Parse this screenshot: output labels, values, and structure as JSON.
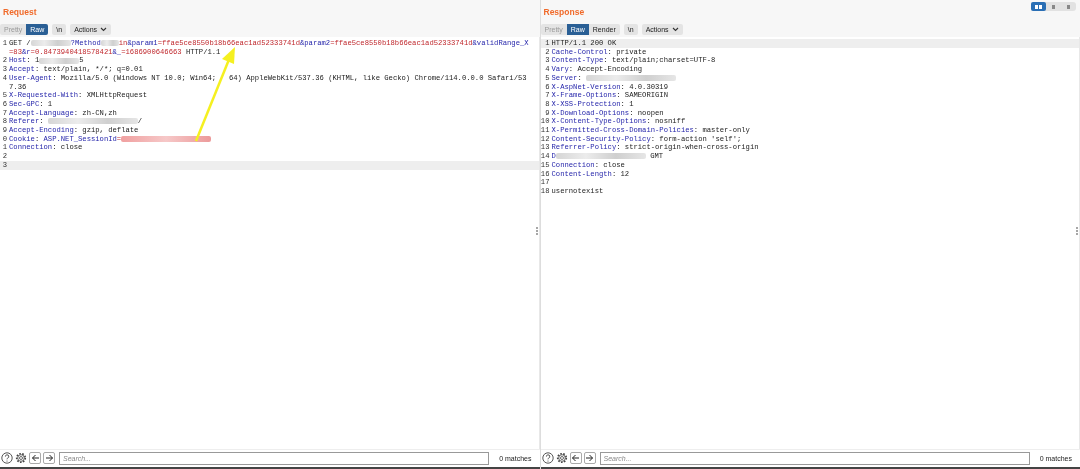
{
  "layout_buttons": [
    {
      "selected": true
    },
    {
      "selected": false
    },
    {
      "selected": false
    }
  ],
  "panes": [
    {
      "title": "Request",
      "tabs": [
        {
          "label": "Pretty",
          "selected": false,
          "disabled": true
        },
        {
          "label": "Raw",
          "selected": true,
          "disabled": false
        }
      ],
      "newline_button": "\\n",
      "actions_button": "Actions",
      "arrow_annotation": true,
      "lines": [
        {
          "number": "1",
          "active": false,
          "segments": [
            {
              "kind": "plain",
              "text": "GET /"
            },
            {
              "kind": "blur_medium"
            },
            {
              "kind": "param",
              "text": "?Method"
            },
            {
              "kind": "blur_short"
            },
            {
              "kind": "value",
              "text": "in"
            },
            {
              "kind": "param",
              "text": "&param1"
            },
            {
              "kind": "value",
              "text": "=ffae5ce8550b18b66eac1ad52333741d"
            },
            {
              "kind": "param",
              "text": "&param2"
            },
            {
              "kind": "value",
              "text": "=ffae5ce8550b18b66eac1ad52333741d"
            },
            {
              "kind": "param",
              "text": "&validRange_X"
            },
            {
              "kind": "value",
              "text": "=83"
            },
            {
              "kind": "param",
              "text": "&r"
            },
            {
              "kind": "value",
              "text": "=0.8473940418578421"
            },
            {
              "kind": "param",
              "text": "&_"
            },
            {
              "kind": "value",
              "text": "=1686900646663"
            },
            {
              "kind": "plain",
              "text": " HTTP/1.1"
            }
          ]
        },
        {
          "number": "2",
          "active": false,
          "segments": [
            {
              "kind": "key",
              "text": "Host"
            },
            {
              "kind": "plain",
              "text": ": 1"
            },
            {
              "kind": "blur_medium"
            },
            {
              "kind": "plain",
              "text": "5"
            }
          ]
        },
        {
          "number": "3",
          "active": false,
          "segments": [
            {
              "kind": "key",
              "text": "Accept"
            },
            {
              "kind": "plain",
              "text": ": text/plain, */*; q=0.01"
            }
          ]
        },
        {
          "number": "4",
          "active": false,
          "segments": [
            {
              "kind": "key",
              "text": "User-Agent"
            },
            {
              "kind": "plain",
              "text": ": Mozilla/5.0 (Windows NT 10.0; Win64; "
            },
            {
              "kind": "covered"
            },
            {
              "kind": "plain",
              "text": "64) AppleWebKit/537.36 (KHTML, like Gecko) Chrome/114.0.0.0 Safari/537.36"
            }
          ]
        },
        {
          "number": "5",
          "active": false,
          "segments": [
            {
              "kind": "key",
              "text": "X-Requested-With"
            },
            {
              "kind": "plain",
              "text": ": XMLHttpRequest"
            }
          ]
        },
        {
          "number": "6",
          "active": false,
          "segments": [
            {
              "kind": "key",
              "text": "Sec-GPC"
            },
            {
              "kind": "plain",
              "text": ": 1"
            }
          ]
        },
        {
          "number": "7",
          "active": false,
          "segments": [
            {
              "kind": "key",
              "text": "Accept-Language"
            },
            {
              "kind": "plain",
              "text": ": zh-CN,zh"
            }
          ]
        },
        {
          "number": "8",
          "active": false,
          "segments": [
            {
              "kind": "key",
              "text": "Referer"
            },
            {
              "kind": "plain",
              "text": ": "
            },
            {
              "kind": "blur_long"
            },
            {
              "kind": "plain",
              "text": "/"
            }
          ]
        },
        {
          "number": "9",
          "active": false,
          "segments": [
            {
              "kind": "key",
              "text": "Accept-Encoding"
            },
            {
              "kind": "plain",
              "text": ": gzip, deflate"
            }
          ]
        },
        {
          "number": "0",
          "active": false,
          "segments": [
            {
              "kind": "key",
              "text": "Cookie"
            },
            {
              "kind": "plain",
              "text": ": "
            },
            {
              "kind": "param",
              "text": "ASP.NET_SessionId"
            },
            {
              "kind": "value",
              "text": "="
            },
            {
              "kind": "blur_red"
            }
          ]
        },
        {
          "number": "1",
          "active": false,
          "segments": [
            {
              "kind": "key",
              "text": "Connection"
            },
            {
              "kind": "plain",
              "text": ": close"
            }
          ]
        },
        {
          "number": "2",
          "active": false
        },
        {
          "number": "3",
          "active": true
        }
      ],
      "search": {
        "placeholder": "Search..."
      },
      "matches": "0 matches"
    },
    {
      "title": "Response",
      "tabs": [
        {
          "label": "Pretty",
          "selected": false,
          "disabled": true
        },
        {
          "label": "Raw",
          "selected": true,
          "disabled": false
        },
        {
          "label": "Render",
          "selected": false,
          "disabled": false
        }
      ],
      "newline_button": "\\n",
      "actions_button": "Actions",
      "lines": [
        {
          "number": "1",
          "active": true,
          "segments": [
            {
              "kind": "plain",
              "text": "HTTP/1.1 200 OK"
            }
          ]
        },
        {
          "number": "2",
          "active": false,
          "segments": [
            {
              "kind": "key",
              "text": "Cache-Control"
            },
            {
              "kind": "plain",
              "text": ": private"
            }
          ]
        },
        {
          "number": "3",
          "active": false,
          "segments": [
            {
              "kind": "key",
              "text": "Content-Type"
            },
            {
              "kind": "plain",
              "text": ": text/plain;charset=UTF-8"
            }
          ]
        },
        {
          "number": "4",
          "active": false,
          "segments": [
            {
              "kind": "key",
              "text": "Vary"
            },
            {
              "kind": "plain",
              "text": ": Accept-Encoding"
            }
          ]
        },
        {
          "number": "5",
          "active": false,
          "segments": [
            {
              "kind": "key",
              "text": "Server"
            },
            {
              "kind": "plain",
              "text": ": "
            },
            {
              "kind": "blur_long"
            }
          ]
        },
        {
          "number": "6",
          "active": false,
          "segments": [
            {
              "kind": "key",
              "text": "X-AspNet-Version"
            },
            {
              "kind": "plain",
              "text": ": 4.0.30319"
            }
          ]
        },
        {
          "number": "7",
          "active": false,
          "segments": [
            {
              "kind": "key",
              "text": "X-Frame-Options"
            },
            {
              "kind": "plain",
              "text": ": SAMEORIGIN"
            }
          ]
        },
        {
          "number": "8",
          "active": false,
          "segments": [
            {
              "kind": "key",
              "text": "X-XSS-Protection"
            },
            {
              "kind": "plain",
              "text": ": 1"
            }
          ]
        },
        {
          "number": "9",
          "active": false,
          "segments": [
            {
              "kind": "key",
              "text": "X-Download-Options"
            },
            {
              "kind": "plain",
              "text": ": noopen"
            }
          ]
        },
        {
          "number": "10",
          "active": false,
          "segments": [
            {
              "kind": "key",
              "text": "X-Content-Type-Options"
            },
            {
              "kind": "plain",
              "text": ": nosniff"
            }
          ]
        },
        {
          "number": "11",
          "active": false,
          "segments": [
            {
              "kind": "key",
              "text": "X-Permitted-Cross-Domain-Policies"
            },
            {
              "kind": "plain",
              "text": ": master-only"
            }
          ]
        },
        {
          "number": "12",
          "active": false,
          "segments": [
            {
              "kind": "key",
              "text": "Content-Security-Policy"
            },
            {
              "kind": "plain",
              "text": ": form-action 'self';"
            }
          ]
        },
        {
          "number": "13",
          "active": false,
          "segments": [
            {
              "kind": "key",
              "text": "Referrer-Policy"
            },
            {
              "kind": "plain",
              "text": ": strict-origin-when-cross-origin"
            }
          ]
        },
        {
          "number": "14",
          "active": false,
          "segments": [
            {
              "kind": "key",
              "text": "D"
            },
            {
              "kind": "blur_long"
            },
            {
              "kind": "plain",
              "text": " GMT"
            }
          ]
        },
        {
          "number": "15",
          "active": false,
          "segments": [
            {
              "kind": "key",
              "text": "Connection"
            },
            {
              "kind": "plain",
              "text": ": close"
            }
          ]
        },
        {
          "number": "16",
          "active": false,
          "segments": [
            {
              "kind": "key",
              "text": "Content-Length"
            },
            {
              "kind": "plain",
              "text": ": 12"
            }
          ]
        },
        {
          "number": "17",
          "active": false
        },
        {
          "number": "18",
          "active": false,
          "segments": [
            {
              "kind": "plain",
              "text": "usernotexist"
            }
          ]
        }
      ],
      "search": {
        "placeholder": "Search..."
      },
      "matches": "0 matches"
    }
  ]
}
